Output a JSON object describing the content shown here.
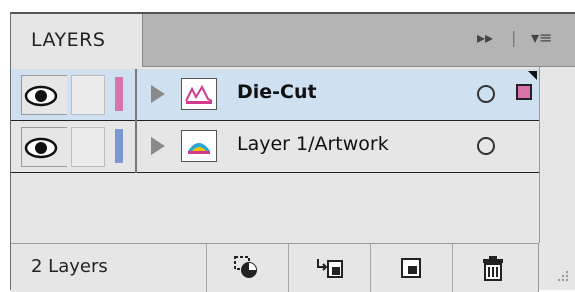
{
  "panel": {
    "tab_label": "LAYERS",
    "controls": {
      "collapse_glyph": "▸▸",
      "menu_glyph": "▾≡"
    }
  },
  "layers": [
    {
      "name": "Die-Cut",
      "color": "#d874a8",
      "selected": true,
      "thumb": "pink-graphic",
      "visible": true
    },
    {
      "name": "Layer 1/Artwork",
      "color": "#7b97d1",
      "selected": false,
      "thumb": "color-graphic",
      "visible": true
    }
  ],
  "footer": {
    "layer_count": "2 Layers",
    "buttons": [
      "make-clipping-mask-icon",
      "create-sublayer-icon",
      "create-layer-icon",
      "trash-icon"
    ]
  }
}
